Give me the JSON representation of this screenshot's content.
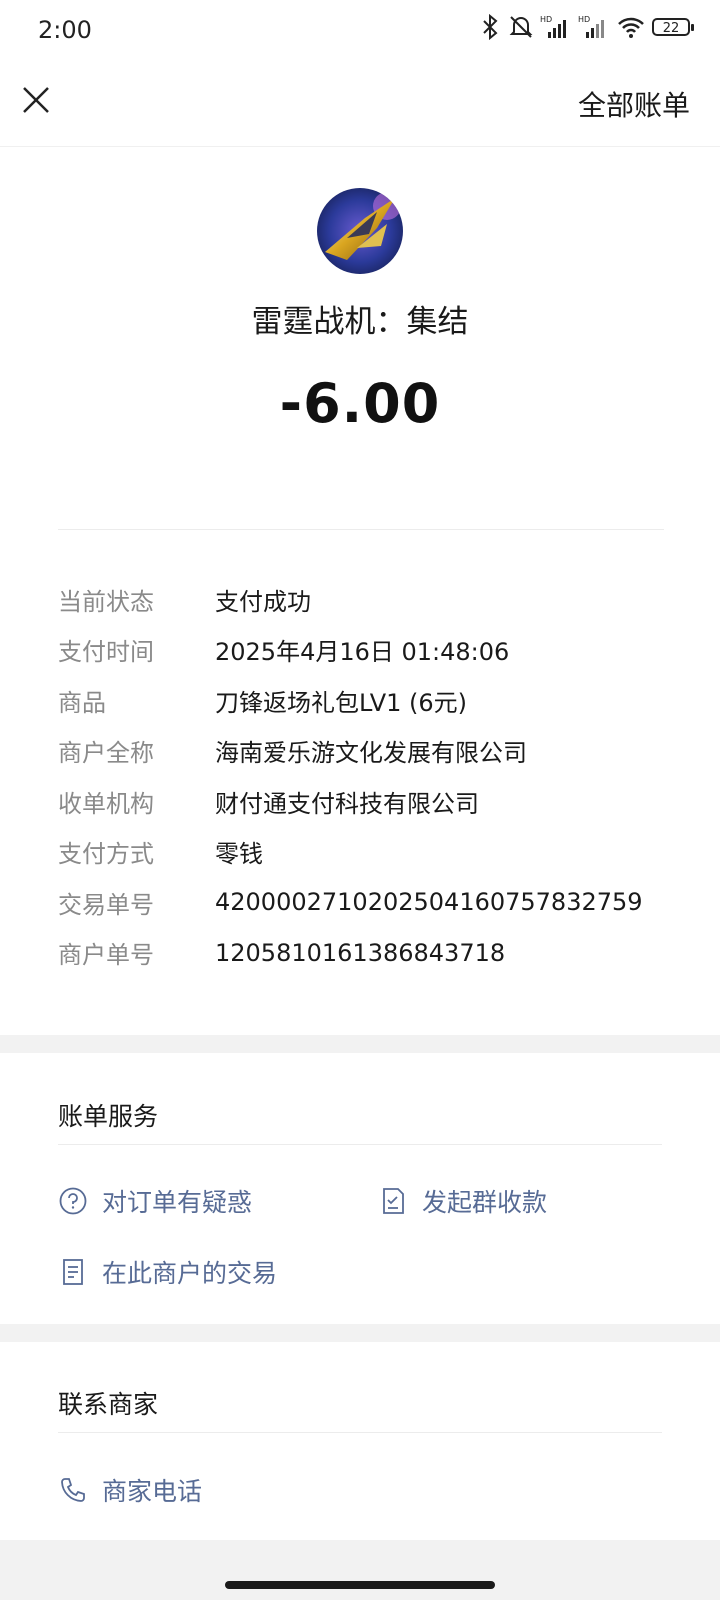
{
  "status_bar": {
    "time": "2:00",
    "battery": "22"
  },
  "header": {
    "right_link": "全部账单"
  },
  "merchant": {
    "name": "雷霆战机：集结",
    "amount": "-6.00"
  },
  "details": [
    {
      "label": "当前状态",
      "value": "支付成功"
    },
    {
      "label": "支付时间",
      "value": "2025年4月16日 01:48:06"
    },
    {
      "label": "商品",
      "value": "刀锋返场礼包LV1 (6元)"
    },
    {
      "label": "商户全称",
      "value": "海南爱乐游文化发展有限公司"
    },
    {
      "label": "收单机构",
      "value": "财付通支付科技有限公司"
    },
    {
      "label": "支付方式",
      "value": "零钱"
    },
    {
      "label": "交易单号",
      "value": "4200002710202504160757832759"
    },
    {
      "label": "商户单号",
      "value": "1205810161386843718"
    }
  ],
  "bill_service": {
    "title": "账单服务",
    "links": [
      {
        "label": "对订单有疑惑",
        "icon": "question-circle-icon"
      },
      {
        "label": "发起群收款",
        "icon": "checklist-doc-icon"
      },
      {
        "label": "在此商户的交易",
        "icon": "document-icon"
      }
    ]
  },
  "contact": {
    "title": "联系商家",
    "links": [
      {
        "label": "商家电话",
        "icon": "phone-icon"
      }
    ]
  },
  "colors": {
    "link": "#576b95",
    "label_gray": "#8a8a8a",
    "band_gray": "#f2f2f2"
  }
}
